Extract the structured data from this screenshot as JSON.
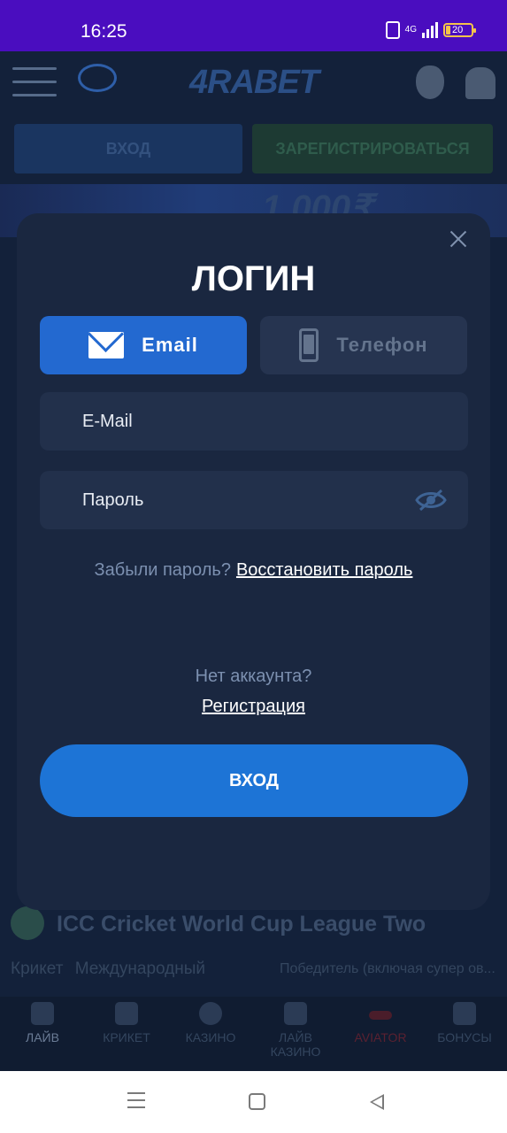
{
  "status_bar": {
    "time": "16:25",
    "network": "4G",
    "battery": "20"
  },
  "background_app": {
    "logo": "4RABET",
    "login_button": "ВХОД",
    "register_button": "ЗАРЕГИСТРИРОВАТЬСЯ",
    "banner_text": "1 000₹",
    "match": {
      "title": "ICC Cricket World Cup League Two",
      "sport": "Крикет",
      "category": "Международный",
      "market": "Победитель (включая супер ов..."
    },
    "bottom_nav": [
      {
        "label": "ЛАЙВ",
        "icon": "live-icon"
      },
      {
        "label": "КРИКЕТ",
        "icon": "cricket-icon"
      },
      {
        "label": "КАЗИНО",
        "icon": "casino-icon"
      },
      {
        "label": "ЛАЙВ КАЗИНО",
        "icon": "dice-icon"
      },
      {
        "label": "AVIATOR",
        "icon": "plane-icon"
      },
      {
        "label": "БОНУСЫ",
        "icon": "gift-icon"
      }
    ]
  },
  "login_modal": {
    "title": "ЛОГИН",
    "tabs": {
      "email": "Email",
      "phone": "Телефон"
    },
    "email_placeholder": "E-Mail",
    "password_placeholder": "Пароль",
    "forgot_question": "Забыли пароль?",
    "restore_link": "Восстановить пароль",
    "no_account": "Нет аккаунта?",
    "register_link": "Регистрация",
    "submit_button": "ВХОД"
  },
  "colors": {
    "accent": "#2369d0",
    "submit": "#1d74d6",
    "status_bar": "#4a0dbf",
    "modal_bg": "#1a2740"
  }
}
